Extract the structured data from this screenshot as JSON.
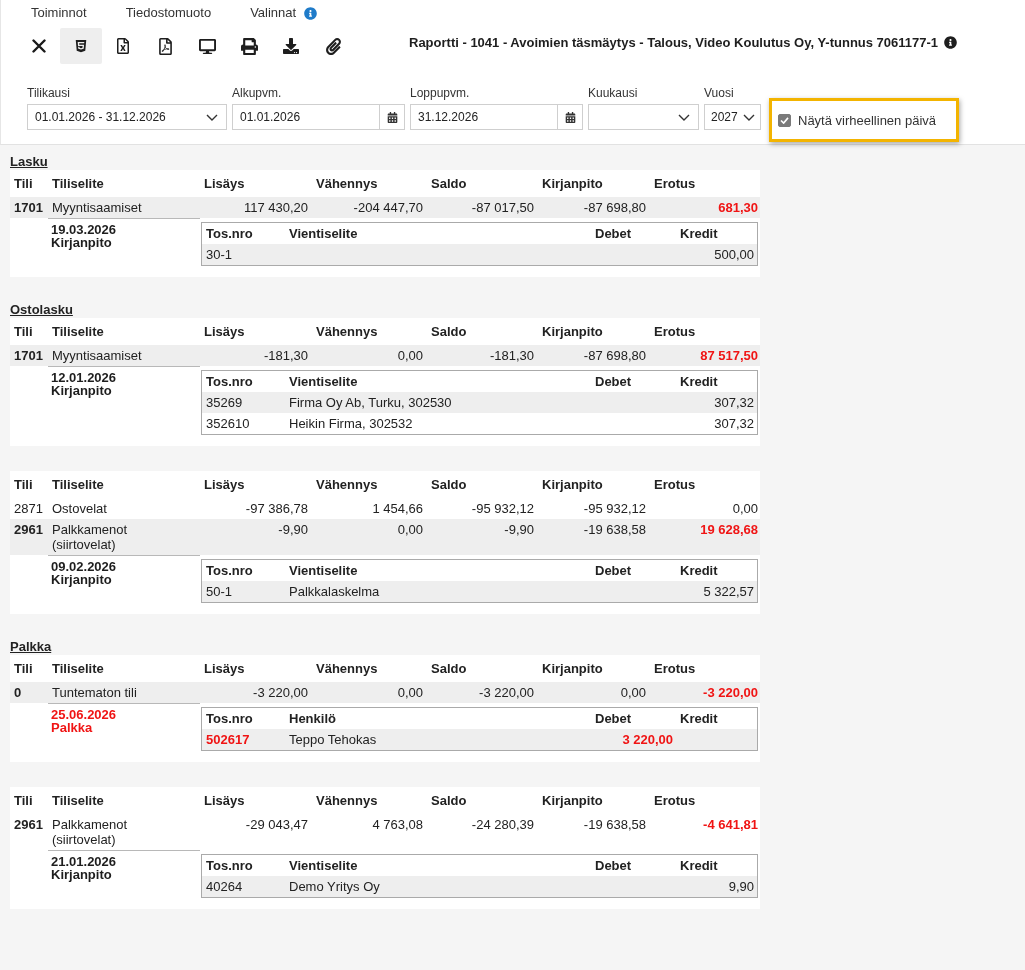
{
  "menu": {
    "items": [
      {
        "label": "Toiminnot",
        "info": false
      },
      {
        "label": "Tiedostomuoto",
        "info": false
      },
      {
        "label": "Valinnat",
        "info": true
      }
    ]
  },
  "toolbar": [
    {
      "kind": "close",
      "selected": false
    },
    {
      "kind": "html",
      "selected": true
    },
    {
      "kind": "excel",
      "selected": false
    },
    {
      "kind": "pdf",
      "selected": false
    },
    {
      "kind": "screen",
      "selected": false
    },
    {
      "kind": "print",
      "selected": false
    },
    {
      "kind": "download",
      "selected": false
    },
    {
      "kind": "attach",
      "selected": false
    }
  ],
  "title": {
    "text": "Raportti - 1041 - Avoimien täsmäytys - Talous, Video Koulutus Oy, Y-tunnus 7061177-1",
    "info": true
  },
  "filters": [
    {
      "kind": "select",
      "label": "Tilikausi",
      "value": "01.01.2026 - 31.12.2026"
    },
    {
      "kind": "date",
      "label": "Alkupvm.",
      "value": "01.01.2026"
    },
    {
      "kind": "date",
      "label": "Loppupvm.",
      "value": "31.12.2026"
    },
    {
      "kind": "select",
      "label": "Kuukausi"
    },
    {
      "kind": "select",
      "label": "Vuosi",
      "value": "2027"
    }
  ],
  "checkbox": {
    "label": "Näytä virheellinen päivä",
    "checked": true,
    "highlighted": true
  },
  "sections": [
    {
      "title": "Lasku",
      "columns": [
        "Tili",
        "Tiliselite",
        "Lisäys",
        "Vähennys",
        "Saldo",
        "Kirjanpito",
        "Erotus"
      ],
      "rows": [
        {
          "tili": "1701",
          "tiliselite": "Myyntisaamiset",
          "lisays": "117 430,20",
          "vahennys": "-204 447,70",
          "saldo": "-87 017,50",
          "kirjanpito": "-87 698,80",
          "erotus": "681,30",
          "error": true,
          "shaded": true
        }
      ],
      "detail": {
        "date": "19.03.2026",
        "source": "Kirjanpito",
        "error": false,
        "columns": [
          "Tos.nro",
          "Vientiselite",
          "Debet",
          "Kredit"
        ],
        "rows": [
          {
            "tos_nro": "30-1",
            "kredit": "500,00",
            "error": false
          }
        ]
      }
    },
    {
      "title": "Ostolasku",
      "columns": [
        "Tili",
        "Tiliselite",
        "Lisäys",
        "Vähennys",
        "Saldo",
        "Kirjanpito",
        "Erotus"
      ],
      "rows": [
        {
          "tili": "1701",
          "tiliselite": "Myyntisaamiset",
          "lisays": "-181,30",
          "vahennys": "0,00",
          "saldo": "-181,30",
          "kirjanpito": "-87 698,80",
          "erotus": "87 517,50",
          "error": true,
          "shaded": true
        }
      ],
      "detail": {
        "date": "12.01.2026",
        "source": "Kirjanpito",
        "error": false,
        "columns": [
          "Tos.nro",
          "Vientiselite",
          "Debet",
          "Kredit"
        ],
        "rows": [
          {
            "tos_nro": "35269",
            "description": "Firma Oy Ab, Turku, 302530",
            "kredit": "307,32",
            "error": false
          },
          {
            "tos_nro": "352610",
            "description": "Heikin Firma, 302532",
            "kredit": "307,32",
            "error": false
          }
        ]
      }
    },
    {
      "columns": [
        "Tili",
        "Tiliselite",
        "Lisäys",
        "Vähennys",
        "Saldo",
        "Kirjanpito",
        "Erotus"
      ],
      "rows": [
        {
          "tili": "2871",
          "tiliselite": "Ostovelat",
          "lisays": "-97 386,78",
          "vahennys": "1 454,66",
          "saldo": "-95 932,12",
          "kirjanpito": "-95 932,12",
          "erotus": "0,00",
          "error": false,
          "shaded": false
        },
        {
          "tili": "2961",
          "tiliselite": "Palkkamenot (siirtovelat)",
          "lisays": "-9,90",
          "vahennys": "0,00",
          "saldo": "-9,90",
          "kirjanpito": "-19 638,58",
          "erotus": "19 628,68",
          "error": true,
          "shaded": true
        }
      ],
      "detail": {
        "date": "09.02.2026",
        "source": "Kirjanpito",
        "error": false,
        "columns": [
          "Tos.nro",
          "Vientiselite",
          "Debet",
          "Kredit"
        ],
        "rows": [
          {
            "tos_nro": "50-1",
            "description": "Palkkalaskelma",
            "kredit": "5 322,57",
            "error": false
          }
        ]
      }
    },
    {
      "title": "Palkka",
      "columns": [
        "Tili",
        "Tiliselite",
        "Lisäys",
        "Vähennys",
        "Saldo",
        "Kirjanpito",
        "Erotus"
      ],
      "rows": [
        {
          "tili": "0",
          "tiliselite": "Tuntematon tili",
          "lisays": "-3 220,00",
          "vahennys": "0,00",
          "saldo": "-3 220,00",
          "kirjanpito": "0,00",
          "erotus": "-3 220,00",
          "error": true,
          "shaded": true
        }
      ],
      "detail": {
        "date": "25.06.2026",
        "source": "Palkka",
        "error": true,
        "columns": [
          "Tos.nro",
          "Henkilö",
          "Debet",
          "Kredit"
        ],
        "rows": [
          {
            "tos_nro": "502617",
            "description": "Teppo Tehokas",
            "debet": "3 220,00",
            "error": true
          }
        ]
      }
    },
    {
      "columns": [
        "Tili",
        "Tiliselite",
        "Lisäys",
        "Vähennys",
        "Saldo",
        "Kirjanpito",
        "Erotus"
      ],
      "rows": [
        {
          "tili": "2961",
          "tiliselite": "Palkkamenot (siirtovelat)",
          "lisays": "-29 043,47",
          "vahennys": "4 763,08",
          "saldo": "-24 280,39",
          "kirjanpito": "-19 638,58",
          "erotus": "-4 641,81",
          "error": true,
          "shaded": false
        }
      ],
      "detail": {
        "date": "21.01.2026",
        "source": "Kirjanpito",
        "error": false,
        "columns": [
          "Tos.nro",
          "Vientiselite",
          "Debet",
          "Kredit"
        ],
        "rows": [
          {
            "tos_nro": "40264",
            "description": "Demo Yritys Oy",
            "kredit": "9,90",
            "error": false
          }
        ]
      }
    }
  ]
}
